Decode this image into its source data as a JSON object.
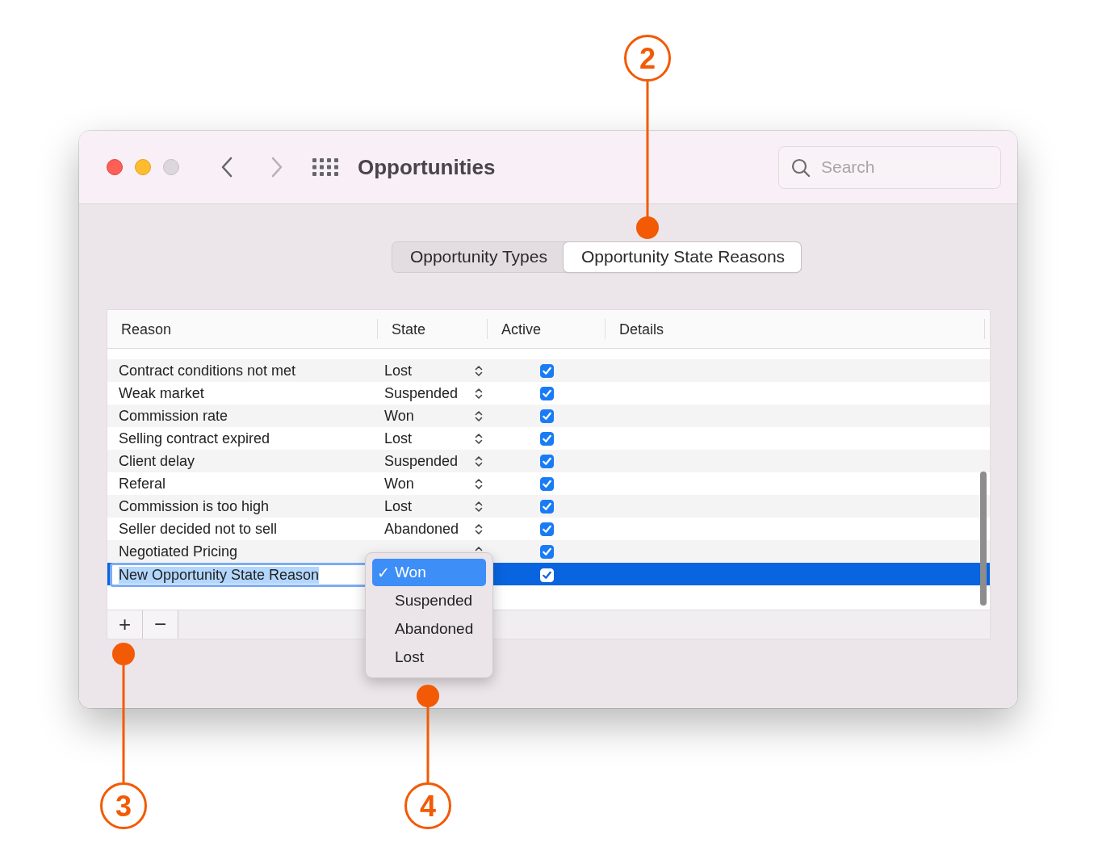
{
  "window": {
    "title": "Opportunities"
  },
  "search": {
    "placeholder": "Search"
  },
  "tabs": [
    {
      "label": "Opportunity Types",
      "selected": false
    },
    {
      "label": "Opportunity State Reasons",
      "selected": true
    }
  ],
  "table": {
    "columns": [
      "Reason",
      "State",
      "Active",
      "Details"
    ],
    "rows": [
      {
        "reason": "Contract conditions not met",
        "state": "Lost",
        "active": true,
        "selected": false
      },
      {
        "reason": "Weak market",
        "state": "Suspended",
        "active": true,
        "selected": false
      },
      {
        "reason": "Commission rate",
        "state": "Won",
        "active": true,
        "selected": false
      },
      {
        "reason": "Selling contract expired",
        "state": "Lost",
        "active": true,
        "selected": false
      },
      {
        "reason": "Client delay",
        "state": "Suspended",
        "active": true,
        "selected": false
      },
      {
        "reason": "Referal",
        "state": "Won",
        "active": true,
        "selected": false
      },
      {
        "reason": "Commission is too high",
        "state": "Lost",
        "active": true,
        "selected": false
      },
      {
        "reason": "Seller decided not to sell",
        "state": "Abandoned",
        "active": true,
        "selected": false
      },
      {
        "reason": "Negotiated Pricing",
        "active": true,
        "selected": false
      },
      {
        "reason": "New Opportunity State Reason",
        "active": true,
        "selected": true,
        "editing": true
      }
    ],
    "footer_buttons": [
      "+",
      "−"
    ]
  },
  "state_menu": {
    "options": [
      {
        "label": "Won",
        "selected": true
      },
      {
        "label": "Suspended",
        "selected": false
      },
      {
        "label": "Abandoned",
        "selected": false
      },
      {
        "label": "Lost",
        "selected": false
      }
    ],
    "check": "✓"
  },
  "callouts": [
    {
      "number": "2"
    },
    {
      "number": "3"
    },
    {
      "number": "4"
    }
  ]
}
